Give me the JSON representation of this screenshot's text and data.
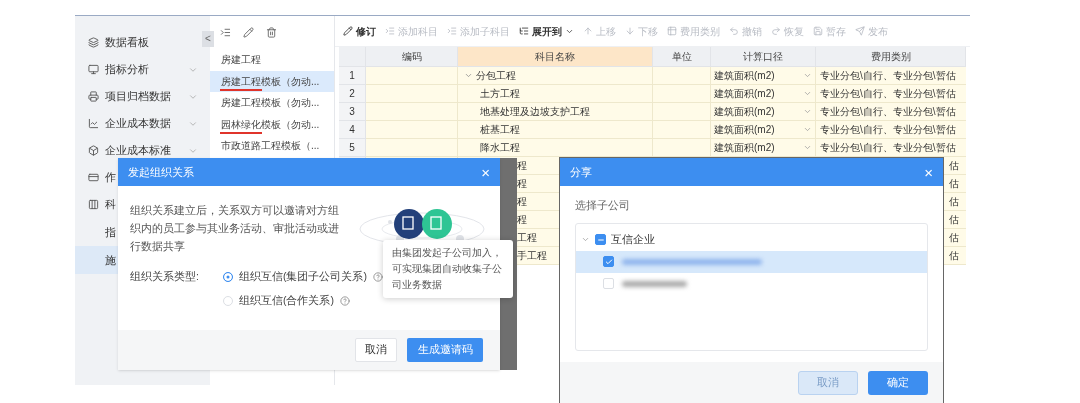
{
  "sidebar": {
    "collapse_glyph": "<",
    "items": [
      {
        "label": "数据看板",
        "expandable": false,
        "selected": false
      },
      {
        "label": "指标分析",
        "expandable": true,
        "selected": false
      },
      {
        "label": "项目归档数据",
        "expandable": true,
        "selected": false
      },
      {
        "label": "企业成本数据",
        "expandable": true,
        "selected": false
      },
      {
        "label": "企业成本标准",
        "expandable": true,
        "selected": false
      },
      {
        "label": "作",
        "selected": false
      },
      {
        "label": "科",
        "selected": false,
        "children": [
          {
            "label": "指",
            "selected": false
          },
          {
            "label": "施",
            "selected": true
          }
        ]
      }
    ]
  },
  "template_list": {
    "items": [
      {
        "label": "房建工程",
        "selected": false,
        "annotated": false
      },
      {
        "label": "房建工程模板（勿动...",
        "selected": true,
        "annotated": true
      },
      {
        "label": "房建工程模板（勿动...",
        "selected": false,
        "annotated": false
      },
      {
        "label": "园林绿化模板（勿动...",
        "selected": false,
        "annotated": true
      },
      {
        "label": "市政道路工程模板（...",
        "selected": false,
        "annotated": false
      }
    ]
  },
  "toolbar": [
    {
      "label": "修订",
      "disabled": false
    },
    {
      "label": "添加科目",
      "disabled": true
    },
    {
      "label": "添加子科目",
      "disabled": true
    },
    {
      "label": "展开到",
      "disabled": false,
      "dropdown": true
    },
    {
      "label": "上移",
      "disabled": true
    },
    {
      "label": "下移",
      "disabled": true
    },
    {
      "label": "费用类别",
      "disabled": true
    },
    {
      "label": "撤销",
      "disabled": true
    },
    {
      "label": "恢复",
      "disabled": true
    },
    {
      "label": "暂存",
      "disabled": true
    },
    {
      "label": "发布",
      "disabled": true
    }
  ],
  "table": {
    "columns": [
      "编码",
      "科目名称",
      "单位",
      "计算口径",
      "费用类别"
    ],
    "rows": [
      {
        "number": "1",
        "name": "分包工程",
        "basis": "建筑面积(m2)",
        "cost_type": "专业分包\\自行、专业分包\\暂估",
        "expanded": true,
        "children": [
          {
            "number": "2",
            "name": "土方工程",
            "basis": "建筑面积(m2)",
            "cost_type": "专业分包\\自行、专业分包\\暂估"
          },
          {
            "number": "3",
            "name": "地基处理及边坡支护工程",
            "basis": "建筑面积(m2)",
            "cost_type": "专业分包\\自行、专业分包\\暂估"
          },
          {
            "number": "4",
            "name": "桩基工程",
            "basis": "建筑面积(m2)",
            "cost_type": "专业分包\\自行、专业分包\\暂估"
          },
          {
            "number": "5",
            "name": "降水工程",
            "basis": "建筑面积(m2)",
            "cost_type": "专业分包\\自行、专业分包\\暂估"
          },
          {
            "name": "程",
            "cost_type": "估"
          },
          {
            "name": "程",
            "cost_type": "估"
          },
          {
            "name": "程",
            "cost_type": "估"
          },
          {
            "name": "程",
            "cost_type": "估"
          },
          {
            "name": "工程",
            "cost_type": "估"
          },
          {
            "name": "手工程",
            "cost_type": "估"
          }
        ]
      }
    ]
  },
  "relation_dialog": {
    "title": "发起组织关系",
    "close": "×",
    "description": "组织关系建立后，关系双方可以邀请对方组织内的员工参与其业务活动、审批活动或进行数据共享",
    "tooltip": "由集团发起子公司加入，可实现集团自动收集子公司业务数据",
    "type_label": "组织关系类型:",
    "options": [
      {
        "label": "组织互信(集团子公司关系)",
        "selected": true
      },
      {
        "label": "组织互信(合作关系)",
        "selected": false
      }
    ],
    "buttons": [
      {
        "label": "取消",
        "kind": "secondary"
      },
      {
        "label": "生成邀请码",
        "kind": "primary"
      }
    ]
  },
  "share_dialog": {
    "title": "分享",
    "close": "×",
    "prompt": "选择子公司",
    "tree": {
      "label": "互信企业",
      "expanded": true,
      "indeterminate": true,
      "children": [
        {
          "checked": true,
          "selected": true
        },
        {
          "checked": false,
          "selected": false
        }
      ]
    },
    "buttons": [
      {
        "label": "取消",
        "kind": "disabled"
      },
      {
        "label": "确定",
        "kind": "primary"
      }
    ]
  }
}
